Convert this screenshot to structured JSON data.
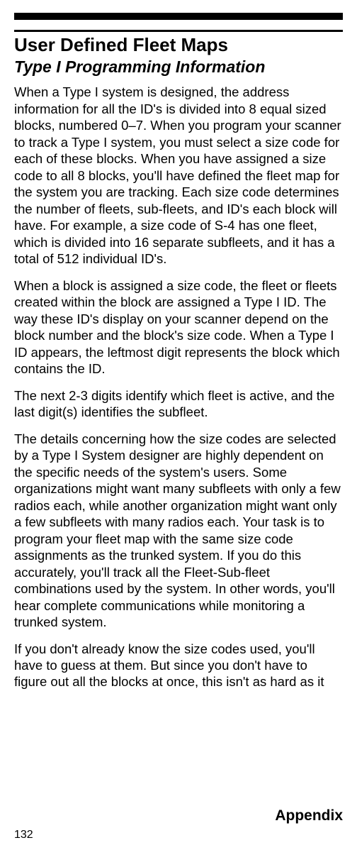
{
  "heading": "User Defined Fleet Maps",
  "subheading": "Type I Programming Information",
  "paragraphs": {
    "p1": "When a Type I system is designed, the address information for all the ID's is divided into 8 equal sized blocks, numbered 0–7. When you program your scanner to track a Type I system, you must select a size code for each of these blocks. When you have assigned a size code to all 8 blocks, you'll have defined the fleet map for the system you are tracking. Each size code determines the number of fleets, sub-fleets, and ID's each block will have. For example, a size code of S-4 has one fleet, which is divided into 16 separate subfleets, and it has a total of 512 individual ID's.",
    "p2": "When a block is assigned a size code, the fleet or fleets created within the block are assigned a Type I ID. The way these ID's display on your scanner depend on the block number and the block's size code. When a Type I ID appears, the leftmost digit represents the block which contains the ID.",
    "p3": "The next 2-3 digits identify which fleet is active, and the last digit(s) identifies the subfleet.",
    "p4": "The details concerning how the size codes are selected by a Type I System designer are highly dependent on the specific needs of the system's users. Some organizations might want many subfleets with only a few radios each, while another organization might want only a few subfleets with many radios each. Your task is to program your fleet map with the same size code assignments as the trunked system. If you do this accurately, you'll track all the Fleet-Sub-fleet combinations used by the system. In other words, you'll hear complete communications while monitoring a trunked system.",
    "p5": "If you don't already know the size codes used, you'll have to guess at them. But since you don't have to figure out all the blocks at once, this isn't as hard as it"
  },
  "footer": "Appendix",
  "pageNumber": "132"
}
